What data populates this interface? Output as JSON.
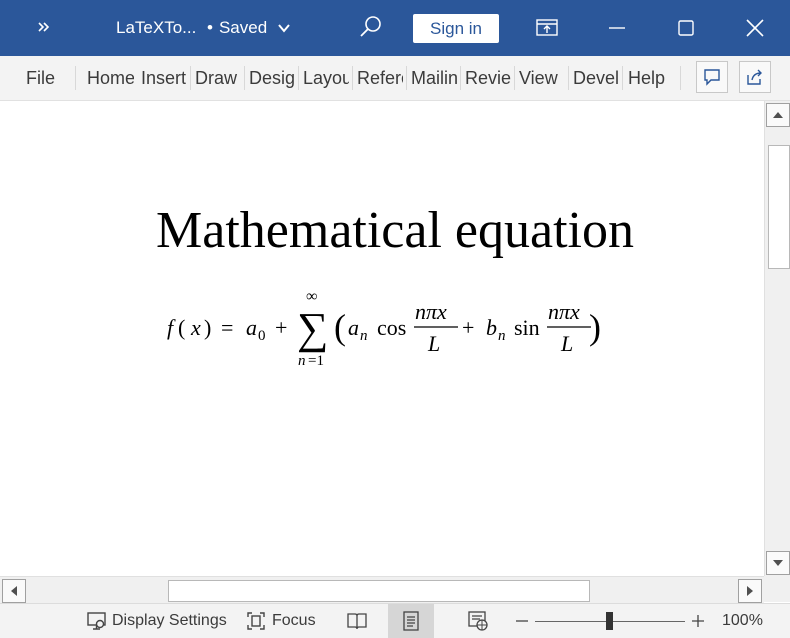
{
  "titlebar": {
    "doc_name": "LaTeXTo...",
    "save_status": "Saved",
    "dot": "•",
    "sign_in": "Sign in",
    "bg_color": "#2b579a"
  },
  "ribbon": {
    "tabs": [
      "File",
      "Home",
      "Insert",
      "Draw",
      "Design",
      "Layout",
      "References",
      "Mailings",
      "Review",
      "View",
      "Developer",
      "Help"
    ]
  },
  "document": {
    "heading": "Mathematical equation",
    "equation_tex": "f(x) = a_0 + \\sum_{n=1}^{\\infty} \\left( a_n \\cos \\frac{n\\pi x}{L} + b_n \\sin \\frac{n\\pi x}{L} \\right)"
  },
  "statusbar": {
    "display_settings": "Display Settings",
    "focus": "Focus",
    "zoom_percent": "100%",
    "zoom_level": 1.0
  },
  "icons": {
    "overflow": "chevron-double-right-icon",
    "search": "search-icon",
    "comments": "comment-icon",
    "share": "share-icon"
  }
}
